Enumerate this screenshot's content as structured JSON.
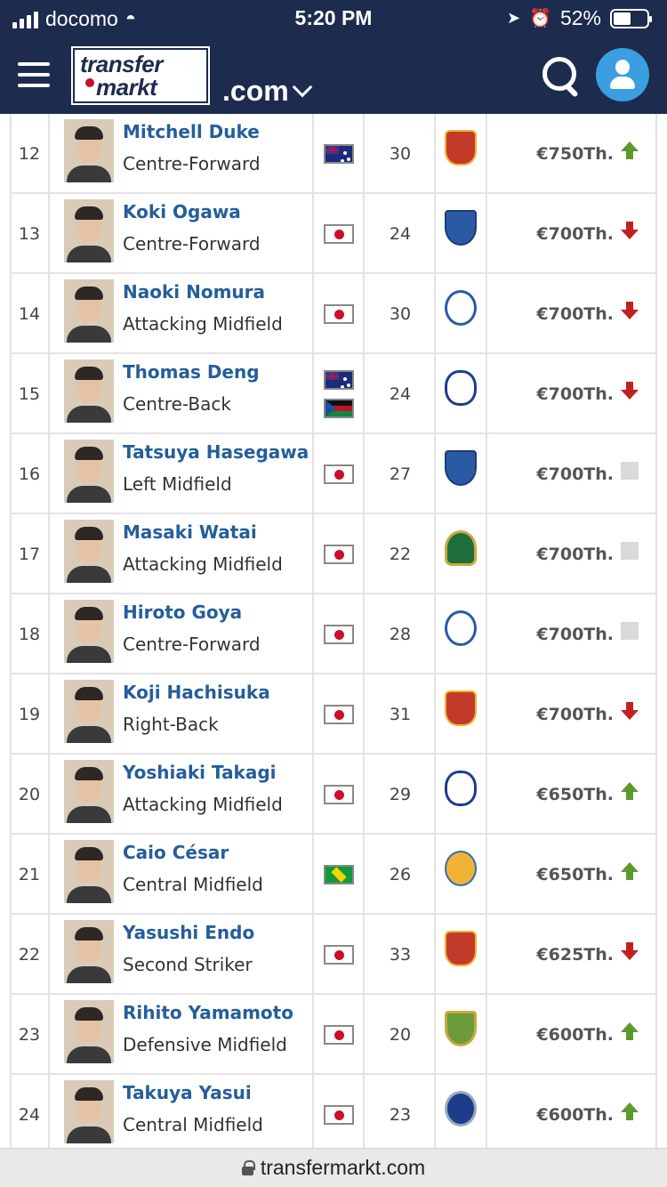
{
  "status_bar": {
    "carrier": "docomo",
    "time": "5:20 PM",
    "battery": "52%",
    "battery_level": 0.52
  },
  "header": {
    "logo_line1": "transfer",
    "logo_line2": "markt",
    "domain": ".com"
  },
  "players": [
    {
      "rank": "12",
      "name": "Mitchell Duke",
      "position": "Centre-Forward",
      "flags": [
        "australia"
      ],
      "age": "30",
      "club_crest": "crest-red",
      "value": "€750Th.",
      "trend": "up"
    },
    {
      "rank": "13",
      "name": "Koki Ogawa",
      "position": "Centre-Forward",
      "flags": [
        "japan"
      ],
      "age": "24",
      "club_crest": "crest-shield",
      "value": "€700Th.",
      "trend": "down"
    },
    {
      "rank": "14",
      "name": "Naoki Nomura",
      "position": "Attacking Midfield",
      "flags": [
        "japan"
      ],
      "age": "30",
      "club_crest": "crest-circle",
      "value": "€700Th.",
      "trend": "down"
    },
    {
      "rank": "15",
      "name": "Thomas Deng",
      "position": "Centre-Back",
      "flags": [
        "australia",
        "south-sudan"
      ],
      "age": "24",
      "club_crest": "crest-navy",
      "value": "€700Th.",
      "trend": "down"
    },
    {
      "rank": "16",
      "name": "Tatsuya Hasegawa",
      "position": "Left Midfield",
      "flags": [
        "japan"
      ],
      "age": "27",
      "club_crest": "crest-shield",
      "value": "€700Th.",
      "trend": "none"
    },
    {
      "rank": "17",
      "name": "Masaki Watai",
      "position": "Attacking Midfield",
      "flags": [
        "japan"
      ],
      "age": "22",
      "club_crest": "crest-green",
      "value": "€700Th.",
      "trend": "none"
    },
    {
      "rank": "18",
      "name": "Hiroto Goya",
      "position": "Centre-Forward",
      "flags": [
        "japan"
      ],
      "age": "28",
      "club_crest": "crest-circle",
      "value": "€700Th.",
      "trend": "none"
    },
    {
      "rank": "19",
      "name": "Koji Hachisuka",
      "position": "Right-Back",
      "flags": [
        "japan"
      ],
      "age": "31",
      "club_crest": "crest-red",
      "value": "€700Th.",
      "trend": "down"
    },
    {
      "rank": "20",
      "name": "Yoshiaki Takagi",
      "position": "Attacking Midfield",
      "flags": [
        "japan"
      ],
      "age": "29",
      "club_crest": "crest-navy",
      "value": "€650Th.",
      "trend": "up"
    },
    {
      "rank": "21",
      "name": "Caio César",
      "position": "Central Midfield",
      "flags": [
        "brazil"
      ],
      "age": "26",
      "club_crest": "crest-yellow",
      "value": "€650Th.",
      "trend": "up"
    },
    {
      "rank": "22",
      "name": "Yasushi Endo",
      "position": "Second Striker",
      "flags": [
        "japan"
      ],
      "age": "33",
      "club_crest": "crest-red",
      "value": "€625Th.",
      "trend": "down"
    },
    {
      "rank": "23",
      "name": "Rihito Yamamoto",
      "position": "Defensive Midfield",
      "flags": [
        "japan"
      ],
      "age": "20",
      "club_crest": "crest-olive",
      "value": "€600Th.",
      "trend": "up"
    },
    {
      "rank": "24",
      "name": "Takuya Yasui",
      "position": "Central Midfield",
      "flags": [
        "japan"
      ],
      "age": "23",
      "club_crest": "crest-darkblue",
      "value": "€600Th.",
      "trend": "up"
    }
  ],
  "bottom_bar": {
    "url": "transfermarkt.com"
  }
}
